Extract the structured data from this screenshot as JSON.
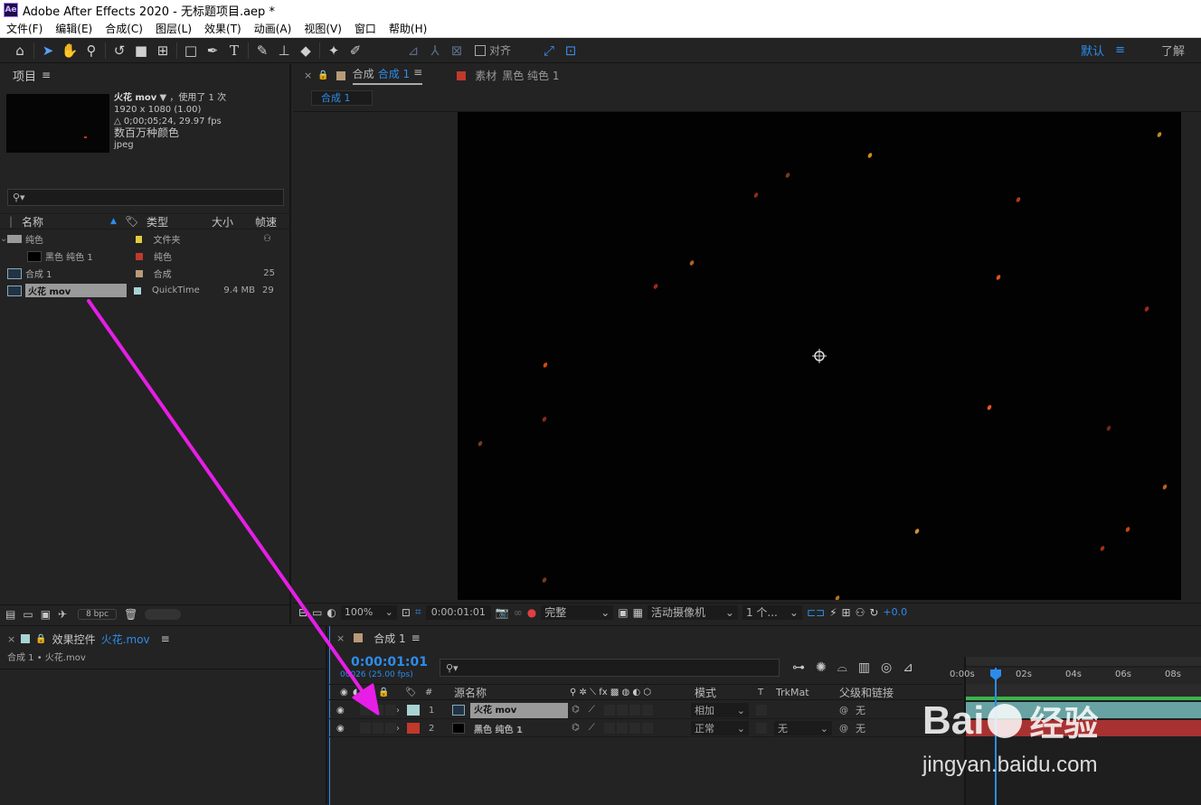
{
  "window": {
    "title": "Adobe After Effects 2020 - 无标题项目.aep *",
    "logo": "Ae"
  },
  "menu": [
    "文件(F)",
    "编辑(E)",
    "合成(C)",
    "图层(L)",
    "效果(T)",
    "动画(A)",
    "视图(V)",
    "窗口",
    "帮助(H)"
  ],
  "toolbar": {
    "icons": [
      "home-icon",
      "selection-icon",
      "hand-icon",
      "zoom-icon",
      "rotate-icon",
      "camera-icon",
      "pan-behind-icon",
      "rectangle-icon",
      "pen-icon",
      "text-icon",
      "brush-icon",
      "clone-stamp-icon",
      "eraser-icon",
      "roto-brush-icon",
      "puppet-pin-icon"
    ],
    "snap_label": "对齐",
    "workspace": "默认",
    "learn": "了解"
  },
  "project": {
    "tab": "项目",
    "preview": {
      "name": "火花 mov",
      "used": "，使用了 1 次",
      "dims": "1920 x 1080 (1.00)",
      "duration": "△ 0;00;05;24, 29.97 fps",
      "colors": "数百万种颜色",
      "codec": "jpeg"
    },
    "columns": {
      "name": "名称",
      "type": "类型",
      "size": "大小",
      "fps": "帧速"
    },
    "items": [
      {
        "name": "纯色",
        "type": "文件夹",
        "size": "",
        "fps": "",
        "color": "#e2cc3c",
        "indent": 0,
        "icon": "folder-icon"
      },
      {
        "name": "黑色 纯色 1",
        "type": "纯色",
        "size": "",
        "fps": "",
        "color": "#c0392b",
        "indent": 1,
        "icon": "solid-icon"
      },
      {
        "name": "合成 1",
        "type": "合成",
        "size": "",
        "fps": "25",
        "color": "#b89a78",
        "indent": 0,
        "icon": "composition-icon"
      },
      {
        "name": "火花 mov",
        "type": "QuickTime",
        "size": "9.4 MB",
        "fps": "29",
        "color": "#a9d3d3",
        "indent": 0,
        "icon": "footage-icon",
        "selected": true
      }
    ],
    "bpc": "8 bpc"
  },
  "viewer": {
    "tabs": [
      {
        "label": "合成",
        "name": "合成 1",
        "color": "#b89a78",
        "active": true
      },
      {
        "label": "素材",
        "name": "黑色 纯色 1",
        "color": "#c0392b",
        "active": false
      }
    ],
    "breadcrumb": "合成 1",
    "bottombar": {
      "zoom": "100%",
      "time": "0:00:01:01",
      "quality": "完整",
      "camera": "活动摄像机",
      "views": "1 个...",
      "exposure": "+0.0"
    }
  },
  "effects": {
    "tab": "效果控件",
    "tab_target": "火花.mov",
    "subtitle": "合成 1 • 火花.mov"
  },
  "timeline": {
    "tab": "合成 1",
    "time": "0:00:01:01",
    "frames": "00026 (25.00 fps)",
    "columns": {
      "num": "#",
      "source": "源名称",
      "mode": "模式",
      "t": "T",
      "trkmat": "TrkMat",
      "parent": "父级和链接"
    },
    "ruler": [
      "0:00s",
      "02s",
      "04s",
      "06s",
      "08s"
    ],
    "layers": [
      {
        "num": "1",
        "name": "火花 mov",
        "color": "#a9d3d3",
        "mode": "相加",
        "trkmat": "",
        "parent": "无",
        "selected": true
      },
      {
        "num": "2",
        "name": "黑色 纯色 1",
        "color": "#c0392b",
        "mode": "正常",
        "trkmat": "无",
        "parent": "无",
        "selected": false
      }
    ]
  },
  "watermark": {
    "brand": "Bai",
    "brand2": "经验",
    "url": "jingyan.baidu.com"
  }
}
